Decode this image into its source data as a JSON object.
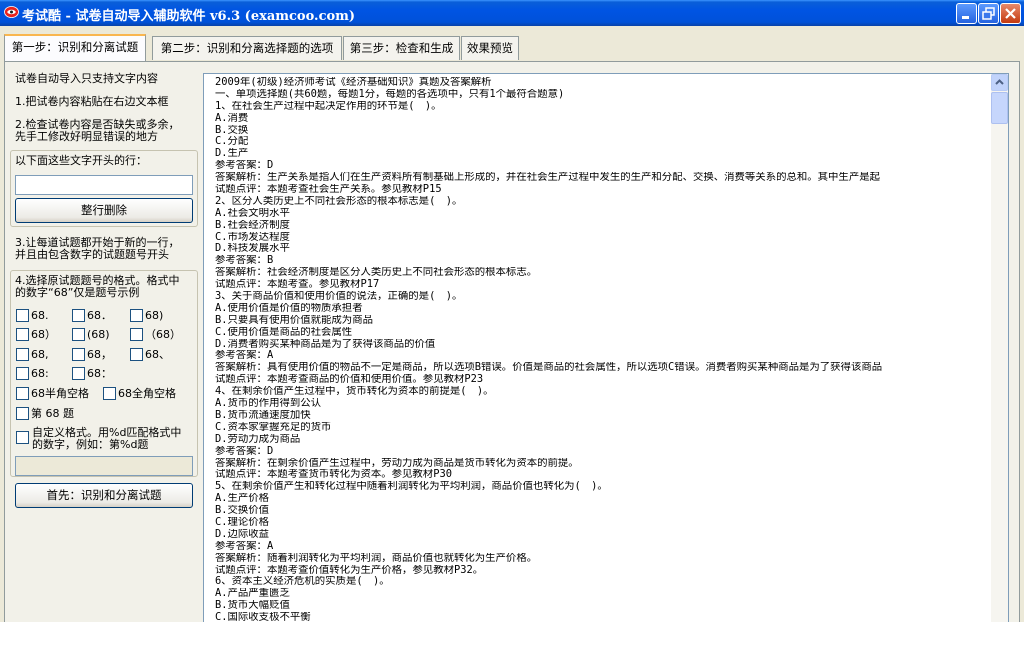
{
  "window": {
    "title": "考试酷 - 试卷自动导入辅助软件 v6.3 (examcoo.com)",
    "controls": [
      "minimize-icon",
      "restore-icon",
      "close-icon"
    ]
  },
  "tabs": [
    {
      "label": "第一步：识别和分离试题",
      "active": true
    },
    {
      "label": "第二步：识别和分离选择题的选项",
      "active": false
    },
    {
      "label": "第三步：检查和生成",
      "active": false
    },
    {
      "label": "效果预览",
      "active": false
    }
  ],
  "left_panel": {
    "intro": "试卷自动导入只支持文字内容",
    "step1": "1.把试卷内容粘贴在右边文本框",
    "step2_line1": "2.检查试卷内容是否缺失或多余，",
    "step2_line2": "先手工修改好明显错误的地方",
    "prefix_label": "以下面这些文字开头的行：",
    "prefix_value": "",
    "delete_button": "整行删除",
    "step3_line1": "3.让每道试题都开始于新的一行，",
    "step3_line2": "并且由包含数字的试题题号开头",
    "step4_line1": "4.选择原试题题号的格式。格式中",
    "step4_line2": "的数字“68”仅是题号示例",
    "formats": [
      [
        "68.",
        "68．",
        "68)"
      ],
      [
        "68）",
        "(68)",
        "（68）"
      ],
      [
        "68,",
        "68，",
        "68、"
      ],
      [
        "68:",
        "68："
      ]
    ],
    "space_half": "68半角空格",
    "space_full": "68全角空格",
    "di_ti": "第 68 题",
    "custom_line1": "自定义格式。用%d匹配格式中",
    "custom_line2": "的数字，例如：第%d题",
    "custom_value": "",
    "main_button": "首先：识别和分离试题"
  },
  "editor": {
    "lines": [
      "2009年(初级)经济师考试《经济基础知识》真题及答案解析",
      "一、单项选择题(共60题，每题1分，每题的各选项中，只有1个最符合题意)",
      "1、在社会生产过程中起决定作用的环节是(　)。",
      "A.消费",
      "B.交换",
      "C.分配",
      "D.生产",
      "参考答案：D",
      "答案解析：生产关系是指人们在生产资料所有制基础上形成的，并在社会生产过程中发生的生产和分配、交换、消费等关系的总和。其中生产是起",
      "试题点评：本题考查社会生产关系。参见教材P15",
      "2、区分人类历史上不同社会形态的根本标志是(　)。",
      "A.社会文明水平",
      "B.社会经济制度",
      "C.市场发达程度",
      "D.科技发展水平",
      "参考答案：B",
      "答案解析：社会经济制度是区分人类历史上不同社会形态的根本标志。",
      "试题点评：本题考查。参见教材P17",
      "3、关于商品价值和使用价值的说法，正确的是(　)。",
      "A.使用价值是价值的物质承担者",
      "B.只要具有使用价值就能成为商品",
      "C.使用价值是商品的社会属性",
      "D.消费者购买某种商品是为了获得该商品的价值",
      "参考答案：A",
      "答案解析：具有使用价值的物品不一定是商品，所以选项B错误。价值是商品的社会属性，所以选项C错误。消费者购买某种商品是为了获得该商品",
      "试题点评：本题考查商品的价值和使用价值。参见教材P23",
      "4、在剩余价值产生过程中，货币转化为资本的前提是(　)。",
      "A.货币的作用得到公认",
      "B.货币流通速度加快",
      "C.资本家掌握充足的货币",
      "D.劳动力成为商品",
      "参考答案：D",
      "答案解析：在剩余价值产生过程中，劳动力成为商品是货币转化为资本的前提。",
      "试题点评：本题考查货币转化为资本。参见教材P30",
      "5、在剩余价值产生和转化过程中随着利润转化为平均利润，商品价值也转化为(　)。",
      "A.生产价格",
      "B.交换价值",
      "C.理论价格",
      "D.边际收益",
      "参考答案：A",
      "答案解析：随着利润转化为平均利润，商品价值也就转化为生产价格。",
      "试题点评：本题考查价值转化为生产价格，参见教材P32。",
      "6、资本主义经济危机的实质是(　)。",
      "A.产品严重匮乏",
      "B.货币大幅贬值",
      "C.国际收支极不平衡"
    ]
  }
}
